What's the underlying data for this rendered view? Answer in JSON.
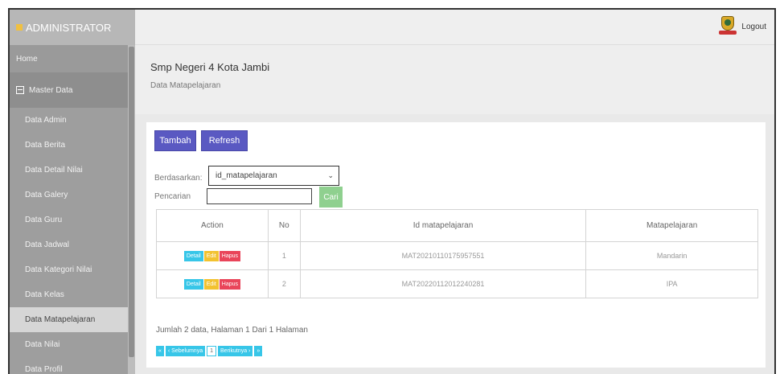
{
  "sidebar": {
    "brand": "ADMINISTRATOR",
    "home": "Home",
    "master": "Master Data",
    "items": [
      {
        "label": "Data Admin"
      },
      {
        "label": "Data Berita"
      },
      {
        "label": "Data Detail Nilai"
      },
      {
        "label": "Data Galery"
      },
      {
        "label": "Data Guru"
      },
      {
        "label": "Data Jadwal"
      },
      {
        "label": "Data Kategori Nilai"
      },
      {
        "label": "Data Kelas"
      },
      {
        "label": "Data Matapelajaran"
      },
      {
        "label": "Data Nilai"
      },
      {
        "label": "Data Profil"
      }
    ],
    "active_item": "Data Matapelajaran"
  },
  "topbar": {
    "logout_label": "Logout"
  },
  "header": {
    "title": "Smp Negeri 4 Kota Jambi",
    "subtitle": "Data Matapelajaran"
  },
  "toolbar": {
    "tambah_label": "Tambah",
    "refresh_label": "Refresh"
  },
  "filter": {
    "based_label": "Berdasarkan:",
    "based_value": "id_matapelajaran",
    "search_label": "Pencarian",
    "search_value": "",
    "search_button": "Cari"
  },
  "table": {
    "headers": [
      "Action",
      "No",
      "Id matapelajaran",
      "Matapelajaran"
    ],
    "action_labels": {
      "detail": "Detail",
      "edit": "Edit",
      "hapus": "Hapus"
    },
    "rows": [
      {
        "no": "1",
        "id": "MAT20210110175957551",
        "name": "Mandarin"
      },
      {
        "no": "2",
        "id": "MAT20220112012240281",
        "name": "IPA"
      }
    ]
  },
  "summary": "Jumlah 2 data, Halaman 1 Dari 1 Halaman",
  "pagination": {
    "first": "«",
    "prev": "‹ Sebelumnya",
    "current": "1",
    "next": "Berikutnya ›",
    "last": "»"
  },
  "colors": {
    "primary": "#5a59c2",
    "success": "#8fd08f",
    "info": "#37c6e8",
    "warning": "#f2c230",
    "danger": "#e9455a"
  }
}
